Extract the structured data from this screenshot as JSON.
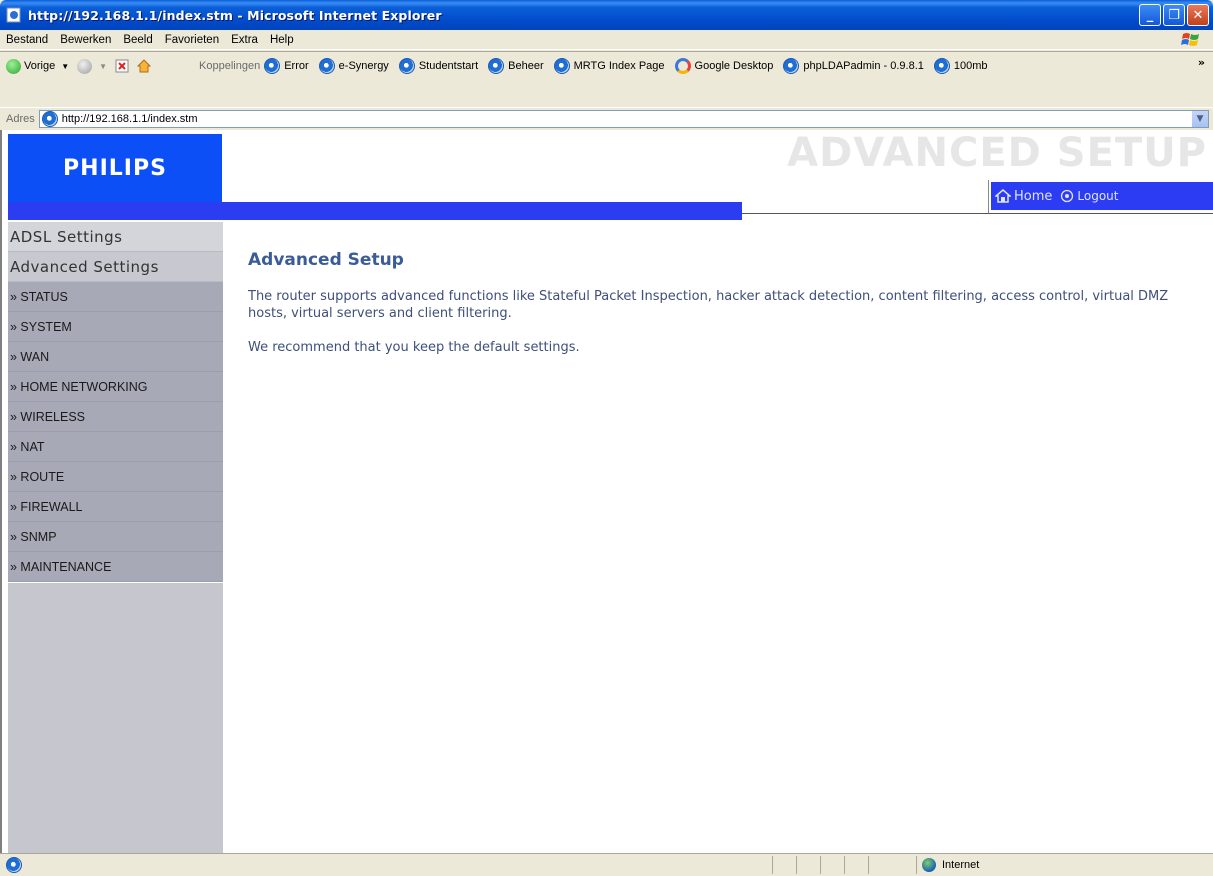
{
  "window": {
    "title": "http://192.168.1.1/index.stm - Microsoft Internet Explorer",
    "controls": [
      "_",
      "❐",
      "✕"
    ]
  },
  "menu": [
    "Bestand",
    "Bewerken",
    "Beeld",
    "Favorieten",
    "Extra",
    "Help"
  ],
  "toolbar": {
    "back_label": "Vorige",
    "links_label": "Koppelingen",
    "links": [
      {
        "label": "Error",
        "icon": "ie-icon"
      },
      {
        "label": "e-Synergy",
        "icon": "ie-icon"
      },
      {
        "label": "Studentstart",
        "icon": "ie-icon"
      },
      {
        "label": "Beheer",
        "icon": "ie-icon"
      },
      {
        "label": "MRTG Index Page",
        "icon": "ie-icon"
      },
      {
        "label": "Google Desktop",
        "icon": "google-desktop-icon"
      },
      {
        "label": "phpLDAPadmin - 0.9.8.1",
        "icon": "ie-icon"
      },
      {
        "label": "100mb",
        "icon": "ie-icon"
      }
    ]
  },
  "address": {
    "label": "Adres",
    "url": "http://192.168.1.1/index.stm"
  },
  "header": {
    "logo": "PHILIPS",
    "banner": "ADVANCED SETUP",
    "home_label": "Home",
    "logout_label": "Logout"
  },
  "sidebar": {
    "sections": [
      "ADSL Settings",
      "Advanced Settings"
    ],
    "items": [
      "» STATUS",
      "» SYSTEM",
      "» WAN",
      "» HOME NETWORKING",
      "» WIRELESS",
      "» NAT",
      "» ROUTE",
      "» FIREWALL",
      "» SNMP",
      "» MAINTENANCE"
    ]
  },
  "content": {
    "heading": "Advanced Setup",
    "para1": "The router supports advanced functions like Stateful Packet Inspection, hacker attack detection, content filtering, access control, virtual DMZ hosts, virtual servers and client filtering.",
    "para2": "We recommend that you keep the default settings."
  },
  "status": {
    "zone": "Internet"
  },
  "colors": {
    "philips_blue": "#0d4ff6",
    "strip_blue": "#2a3df0",
    "heading": "#3a5c98"
  }
}
